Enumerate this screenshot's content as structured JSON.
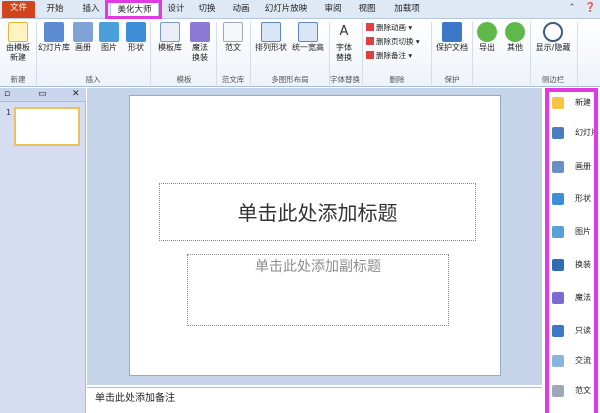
{
  "tabs": [
    {
      "label": "文件"
    },
    {
      "label": "开始"
    },
    {
      "label": "插入"
    },
    {
      "label": "美化大师"
    },
    {
      "label": "设计"
    },
    {
      "label": "切换"
    },
    {
      "label": "动画"
    },
    {
      "label": "幻灯片放映"
    },
    {
      "label": "审阅"
    },
    {
      "label": "视图"
    },
    {
      "label": "加载项"
    }
  ],
  "ribbon": {
    "new": {
      "label1": "由模板",
      "label2": "新建",
      "group": "新建"
    },
    "insert": {
      "gallery": "幻灯片库",
      "album": "画册",
      "picture": "图片",
      "shape": "形状",
      "group": "插入"
    },
    "template": {
      "lib": "模板库",
      "magic1": "魔法",
      "magic2": "换装",
      "group": "模板"
    },
    "fanwen": {
      "label": "范文",
      "group": "范文库"
    },
    "layout": {
      "arrange": "排列形状",
      "uniform": "统一宽高",
      "group": "多图形布局"
    },
    "font": {
      "label1": "字体",
      "label2": "替换",
      "group": "字体替换"
    },
    "delete": {
      "anim": "删除动画",
      "trans": "删除页切换",
      "notes": "删除备注",
      "group": "删除"
    },
    "protect": {
      "label": "保护文档",
      "group": "保护"
    },
    "export": {
      "label": "导出"
    },
    "other": {
      "label": "其他"
    },
    "show": {
      "label": "显示/隐藏",
      "group": "侧边栏"
    }
  },
  "slide": {
    "title_placeholder": "单击此处添加标题",
    "subtitle_placeholder": "单击此处添加副标题",
    "number": "1"
  },
  "notes_placeholder": "单击此处添加备注",
  "sidebar": [
    {
      "label": "新建",
      "icon": "new-icon",
      "color": "#f5c542"
    },
    {
      "label": "幻灯片",
      "icon": "slides-icon",
      "color": "#4a7cc2"
    },
    {
      "label": "画册",
      "icon": "album-icon",
      "color": "#6a8fc4"
    },
    {
      "label": "形状",
      "icon": "shape-icon",
      "color": "#3d8ed6"
    },
    {
      "label": "图片",
      "icon": "picture-icon",
      "color": "#5aa0d8"
    },
    {
      "label": "换装",
      "icon": "dress-icon",
      "color": "#2e6db4"
    },
    {
      "label": "魔法",
      "icon": "magic-icon",
      "color": "#7a6ad2"
    },
    {
      "label": "只读",
      "icon": "readonly-icon",
      "color": "#3d78c8"
    },
    {
      "label": "交流",
      "icon": "chat-icon",
      "color": "#8ab4e0"
    },
    {
      "label": "范文",
      "icon": "doc-icon",
      "color": "#9ea8b8"
    }
  ],
  "colors": {
    "highlight": "#e23ae3",
    "file_tab": "#d0451b"
  }
}
